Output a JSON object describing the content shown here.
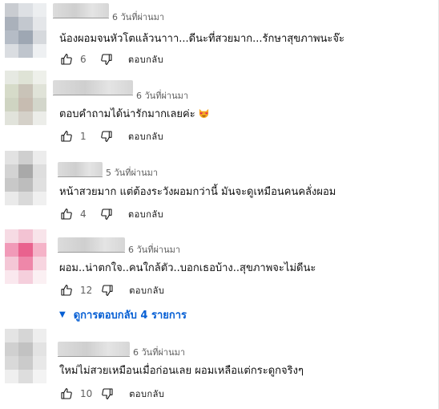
{
  "comments": [
    {
      "time": "6 วันที่ผ่านมา",
      "text": "น้องผอมจนหัวโตแล้วนาาา...ดีนะที่สวยมาก...รักษาสุขภาพนะจ๊ะ",
      "likes": "6",
      "reply_label": "ตอบกลับ"
    },
    {
      "time": "6 วันที่ผ่านมา",
      "text": "ตอบคำถามได้น่ารักมากเลยค่ะ",
      "emoji": "heart-eyes-cat",
      "likes": "1",
      "reply_label": "ตอบกลับ"
    },
    {
      "time": "5 วันที่ผ่านมา",
      "text": "หน้าสวยมาก แต่ต้องระวังผอมกว่านี้ มันจะดูเหมือนคนคลั่งผอม",
      "likes": "4",
      "reply_label": "ตอบกลับ"
    },
    {
      "time": "6 วันที่ผ่านมา",
      "text": "ผอม..น่าตกใจ..คนใกล้ตัว..บอกเธอบ้าง..สุขภาพจะไม่ดีนะ",
      "likes": "12",
      "reply_label": "ตอบกลับ",
      "view_replies": "ดูการตอบกลับ 4 รายการ"
    },
    {
      "time": "6 วันที่ผ่านมา",
      "text": "ใหม่ไม่สวยเหมือนเมื่อก่อนเลย ผอมเหลือแต่กระดูกจริงๆ",
      "likes": "10",
      "reply_label": "ตอบกลับ"
    }
  ],
  "colors": {
    "link": "#065fd4",
    "meta": "#606060",
    "text": "#0f0f0f"
  },
  "icons": [
    "thumb-up-icon",
    "thumb-down-icon",
    "chevron-down-icon",
    "heart-eyes-cat-emoji"
  ]
}
